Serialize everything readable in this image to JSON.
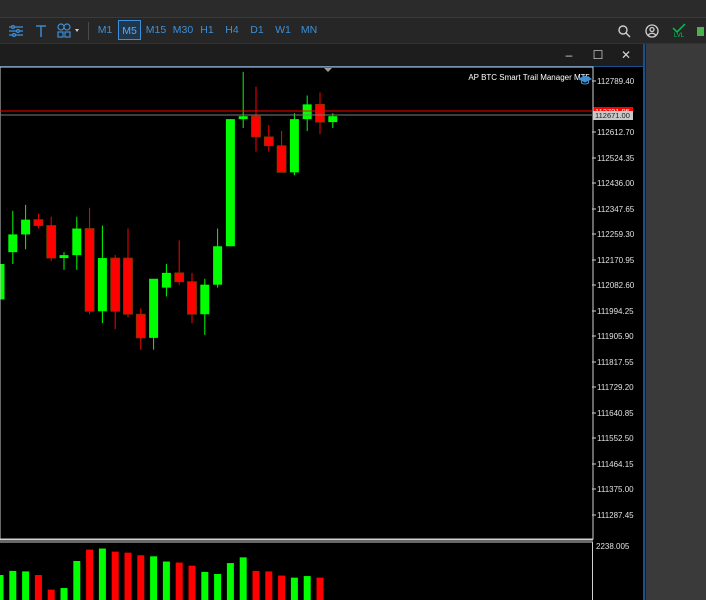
{
  "toolbar": {
    "timeframes": [
      "M1",
      "M5",
      "M15",
      "M30",
      "H1",
      "H4",
      "D1",
      "W1",
      "MN"
    ],
    "active_timeframe": "M5",
    "level_badge": "LVL"
  },
  "window": {
    "minimize_glyph": "–",
    "maximize_glyph": "☐",
    "close_glyph": "✕"
  },
  "indicator_label": "AP BTC Smart Trail Manager MT5",
  "price_axis": {
    "ticks": [
      "112789.40",
      "112612.70",
      "112524.35",
      "112436.00",
      "112347.65",
      "112259.30",
      "112170.95",
      "112082.60",
      "111994.25",
      "111905.90",
      "111817.55",
      "111729.20",
      "111640.85",
      "111552.50",
      "111464.15",
      "111375.00",
      "111287.45"
    ],
    "red_line_label": "112701.05",
    "current_price_label": "112671.00"
  },
  "volume_axis": {
    "top_label": "2238.005"
  },
  "colors": {
    "bull": "#00ff00",
    "bear": "#ff0000",
    "background": "#000000",
    "accent": "#3d8fd9",
    "window_border": "#1c4f8c"
  },
  "chart_data": {
    "type": "candlestick",
    "ylim": [
      111243,
      112833
    ],
    "candles": [
      {
        "o": 112050,
        "h": 112250,
        "l": 112020,
        "c": 112170,
        "dir": "bull",
        "vol": 0.48
      },
      {
        "o": 112210,
        "h": 112350,
        "l": 112170,
        "c": 112270,
        "dir": "bull",
        "vol": 0.56
      },
      {
        "o": 112270,
        "h": 112370,
        "l": 112220,
        "c": 112320,
        "dir": "bull",
        "vol": 0.55
      },
      {
        "o": 112320,
        "h": 112340,
        "l": 112290,
        "c": 112300,
        "dir": "bear",
        "vol": 0.48
      },
      {
        "o": 112300,
        "h": 112330,
        "l": 112180,
        "c": 112190,
        "dir": "bear",
        "vol": 0.2
      },
      {
        "o": 112190,
        "h": 112210,
        "l": 112150,
        "c": 112200,
        "dir": "bull",
        "vol": 0.23
      },
      {
        "o": 112200,
        "h": 112330,
        "l": 112150,
        "c": 112290,
        "dir": "bull",
        "vol": 0.75
      },
      {
        "o": 112290,
        "h": 112360,
        "l": 112000,
        "c": 112010,
        "dir": "bear",
        "vol": 0.97
      },
      {
        "o": 112010,
        "h": 112300,
        "l": 111970,
        "c": 112190,
        "dir": "bull",
        "vol": 0.99
      },
      {
        "o": 112190,
        "h": 112200,
        "l": 111950,
        "c": 112010,
        "dir": "bear",
        "vol": 0.93
      },
      {
        "o": 112190,
        "h": 112290,
        "l": 111990,
        "c": 112000,
        "dir": "bear",
        "vol": 0.91
      },
      {
        "o": 112000,
        "h": 112020,
        "l": 111880,
        "c": 111920,
        "dir": "bear",
        "vol": 0.86
      },
      {
        "o": 111920,
        "h": 112050,
        "l": 111880,
        "c": 112120,
        "dir": "bull",
        "vol": 0.84
      },
      {
        "o": 112090,
        "h": 112170,
        "l": 112060,
        "c": 112140,
        "dir": "bull",
        "vol": 0.74
      },
      {
        "o": 112140,
        "h": 112250,
        "l": 112100,
        "c": 112110,
        "dir": "bear",
        "vol": 0.72
      },
      {
        "o": 112110,
        "h": 112140,
        "l": 111970,
        "c": 112000,
        "dir": "bear",
        "vol": 0.66
      },
      {
        "o": 112000,
        "h": 112120,
        "l": 111930,
        "c": 112100,
        "dir": "bull",
        "vol": 0.54
      },
      {
        "o": 112100,
        "h": 112290,
        "l": 112090,
        "c": 112230,
        "dir": "bull",
        "vol": 0.5
      },
      {
        "o": 112230,
        "h": 112660,
        "l": 112230,
        "c": 112660,
        "dir": "bull",
        "vol": 0.71
      },
      {
        "o": 112660,
        "h": 112820,
        "l": 112630,
        "c": 112670,
        "dir": "bull",
        "vol": 0.82
      },
      {
        "o": 112670,
        "h": 112770,
        "l": 112550,
        "c": 112600,
        "dir": "bear",
        "vol": 0.56
      },
      {
        "o": 112600,
        "h": 112640,
        "l": 112550,
        "c": 112570,
        "dir": "bear",
        "vol": 0.55
      },
      {
        "o": 112570,
        "h": 112620,
        "l": 112480,
        "c": 112480,
        "dir": "bear",
        "vol": 0.47
      },
      {
        "o": 112480,
        "h": 112680,
        "l": 112470,
        "c": 112660,
        "dir": "bull",
        "vol": 0.43
      },
      {
        "o": 112660,
        "h": 112740,
        "l": 112620,
        "c": 112710,
        "dir": "bull",
        "vol": 0.46
      },
      {
        "o": 112710,
        "h": 112750,
        "l": 112610,
        "c": 112650,
        "dir": "bear",
        "vol": 0.43
      },
      {
        "o": 112650,
        "h": 112680,
        "l": 112630,
        "c": 112670,
        "dir": "bull",
        "vol": 0.0
      }
    ]
  }
}
